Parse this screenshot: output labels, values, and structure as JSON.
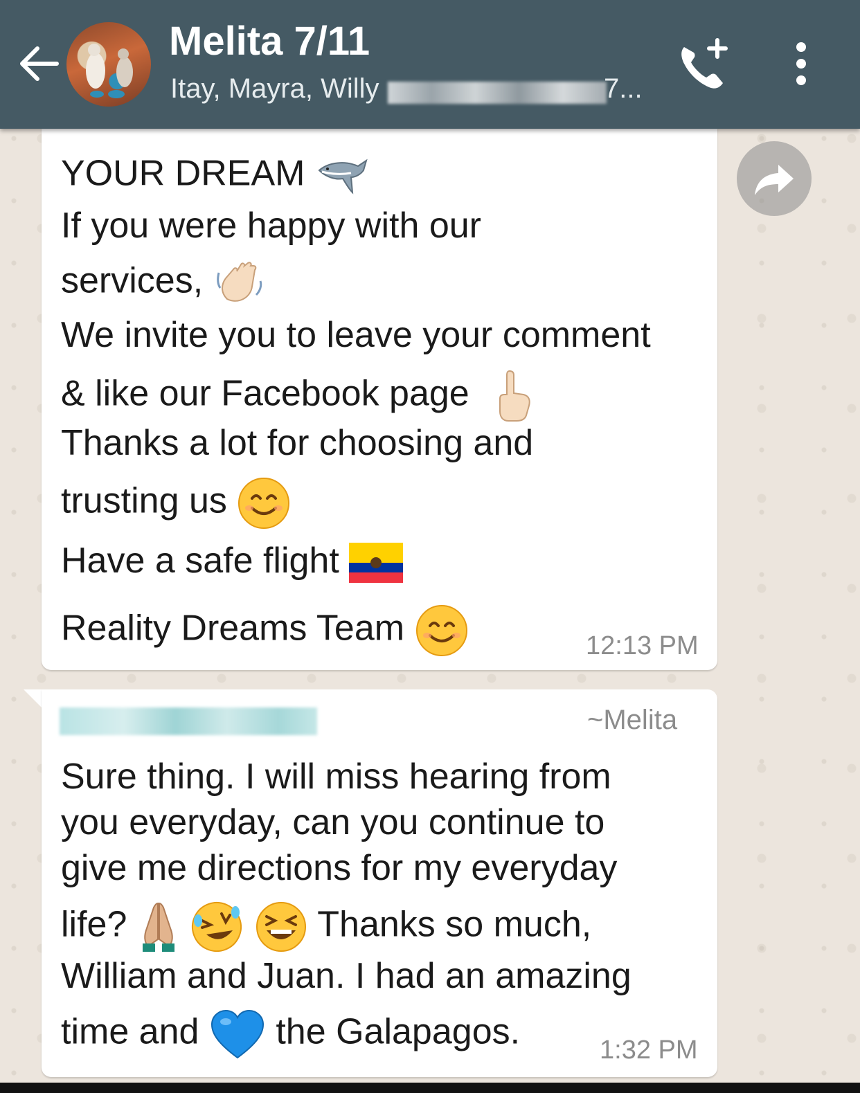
{
  "header": {
    "title": "Melita 7/11",
    "subtitle": "Itay, Mayra, Willy",
    "subtitle_tail": "7..."
  },
  "messages": [
    {
      "lines": [
        "YOUR DREAM",
        "If you were happy with our",
        "services,",
        "We invite you to leave your comment",
        "& like our Facebook page",
        "Thanks a lot for choosing and",
        "trusting us",
        "Have a safe flight",
        "Reality Dreams Team"
      ],
      "time": "12:13 PM"
    },
    {
      "author": "~Melita",
      "lines": [
        "Sure thing. I will miss hearing from",
        "you everyday, can you continue to",
        "give me directions for my everyday",
        "life?",
        "Thanks so much,",
        "William and Juan. I had an amazing",
        "time and",
        "the Galapagos."
      ],
      "time": "1:32 PM"
    }
  ],
  "icons": {
    "back": "arrow-left-icon",
    "call": "add-call-icon",
    "menu": "more-vert-icon",
    "forward": "forward-icon"
  },
  "colors": {
    "appbar": "#455a64",
    "wallpaper": "#ece5dd",
    "bubble": "#ffffff",
    "timestamp": "#8c8c8c"
  }
}
